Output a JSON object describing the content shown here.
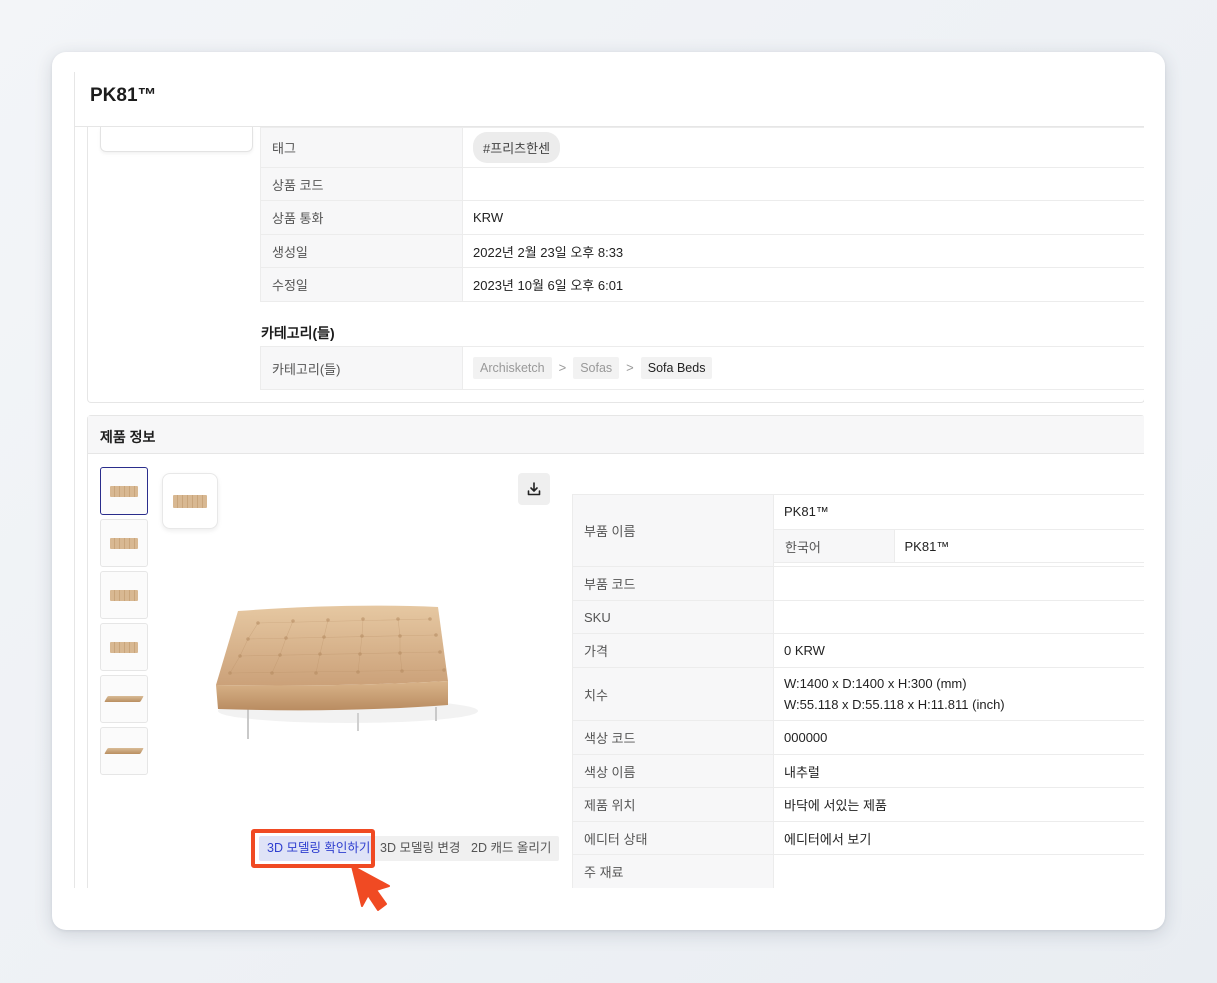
{
  "page": {
    "title": "PK81™"
  },
  "basic_info": {
    "rows": [
      {
        "label": "태그",
        "value": "#프리츠한센"
      },
      {
        "label": "상품 코드",
        "value": ""
      },
      {
        "label": "상품 통화",
        "value": "KRW"
      },
      {
        "label": "생성일",
        "value": "2022년 2월 23일 오후 8:33"
      },
      {
        "label": "수정일",
        "value": "2023년 10월 6일 오후 6:01"
      }
    ]
  },
  "categories": {
    "heading": "카테고리(들)",
    "label": "카테고리(들)",
    "crumbs": [
      "Archisketch",
      "Sofas",
      "Sofa Beds"
    ],
    "separator": ">"
  },
  "product_info": {
    "title": "제품 정보",
    "thumbnails": [
      {
        "icon": "bed-thumbnail-icon"
      },
      {
        "icon": "bed-thumbnail-icon"
      },
      {
        "icon": "bed-thumbnail-icon"
      },
      {
        "icon": "bed-thumbnail-icon"
      },
      {
        "icon": "bench-thumbnail-icon"
      },
      {
        "icon": "bench-thumbnail-icon"
      }
    ],
    "selected_thumbnail": 0,
    "buttons": {
      "check_3d": "3D 모델링 확인하기",
      "change_3d": "3D 모델링 변경",
      "upload_2d": "2D 캐드 올리기"
    },
    "part_name": {
      "label": "부품 이름",
      "value": "PK81™",
      "lang_label": "한국어",
      "lang_value": "PK81™"
    },
    "rows": [
      {
        "label": "부품 코드",
        "value": ""
      },
      {
        "label": "SKU",
        "value": ""
      },
      {
        "label": "가격",
        "value": "0 KRW"
      }
    ],
    "dimensions": {
      "label": "치수",
      "mm": "W:1400 x D:1400 x H:300 (mm)",
      "inch": "W:55.118 x D:55.118 x H:11.811 (inch)"
    },
    "rows2": [
      {
        "label": "색상 코드",
        "value": "000000"
      },
      {
        "label": "색상 이름",
        "value": "내추럴"
      },
      {
        "label": "제품 위치",
        "value": "바닥에 서있는 제품"
      },
      {
        "label": "에디터 상태",
        "value": "에디터에서 보기"
      },
      {
        "label": "주 재료",
        "value": ""
      }
    ]
  },
  "colors": {
    "highlight": "#f04a23",
    "primary_button_text": "#2f3fcf"
  }
}
